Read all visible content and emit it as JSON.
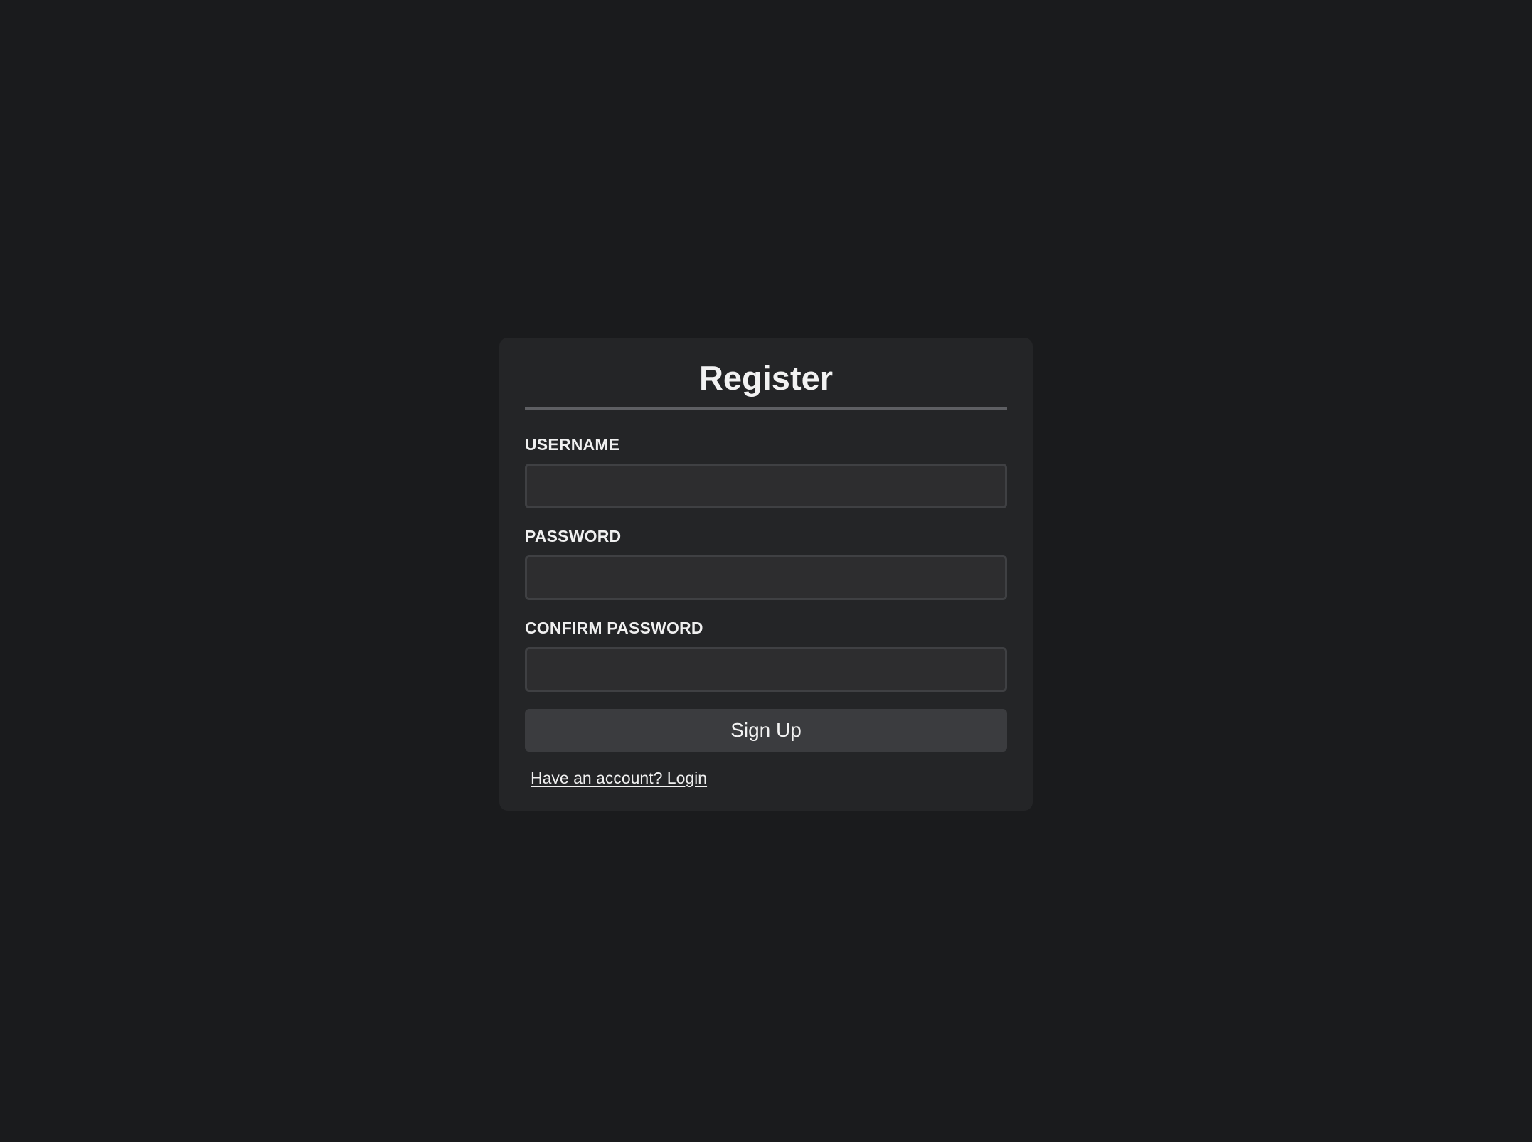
{
  "form": {
    "title": "Register",
    "fields": [
      {
        "label": "USERNAME",
        "value": "",
        "placeholder": ""
      },
      {
        "label": "PASSWORD",
        "value": "",
        "placeholder": ""
      },
      {
        "label": "CONFIRM PASSWORD",
        "value": "",
        "placeholder": ""
      }
    ],
    "submit_label": "Sign Up",
    "login_link": "Have an account? Login"
  },
  "colors": {
    "background": "#1a1b1d",
    "card": "#242527",
    "input_background": "#2d2d2f",
    "button_background": "#3b3c3f",
    "text": "#f0f0f0"
  }
}
